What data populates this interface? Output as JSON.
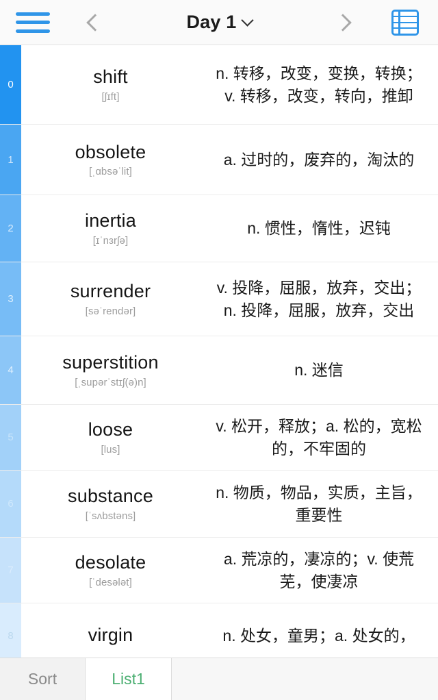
{
  "header": {
    "menu_icon": "hamburger-menu-icon",
    "prev_icon": "chevron-left-icon",
    "next_icon": "chevron-right-icon",
    "title": "Day 1",
    "title_caret_icon": "chevron-down-icon",
    "grid_icon": "list-grid-icon",
    "accent_color": "#2f95e8",
    "background": "#fafafa"
  },
  "list": {
    "index_gradient_from": "#2196f3",
    "index_gradient_to": "#d6e9fb",
    "rows": [
      {
        "index": "0",
        "word": "shift",
        "phonetic": "[ʃɪft]",
        "definition": "n. 转移，改变，变换，转换；v. 转移，改变，转向，推卸",
        "index_color": "#2293f0",
        "num_color": "#ffffff"
      },
      {
        "index": "1",
        "word": "obsolete",
        "phonetic": "[ˌɑbsəˈlit]",
        "definition": "a. 过时的，废弃的，淘汰的",
        "index_color": "#4aa6f2",
        "num_color": "#cfe6fb"
      },
      {
        "index": "2",
        "word": "inertia",
        "phonetic": "[ɪˈnɜrʃə]",
        "definition": "n. 惯性，惰性，迟钝",
        "index_color": "#63b2f4",
        "num_color": "#d8ecfd"
      },
      {
        "index": "3",
        "word": "surrender",
        "phonetic": "[səˈrendər]",
        "definition": "v. 投降，屈服，放弃，交出；n. 投降，屈服，放弃，交出",
        "index_color": "#77bcf6",
        "num_color": "#ddeffd"
      },
      {
        "index": "4",
        "word": "superstition",
        "phonetic": "[ˌsupərˈstɪʃ(ə)n]",
        "definition": "n. 迷信",
        "index_color": "#8cc6f7",
        "num_color": "#e2f1fe"
      },
      {
        "index": "5",
        "word": "loose",
        "phonetic": "[lus]",
        "definition": "v. 松开，释放；a. 松的，宽松的，不牢固的",
        "index_color": "#a2d1f9",
        "num_color": "#c8e4fb"
      },
      {
        "index": "6",
        "word": "substance",
        "phonetic": "[ˈsʌbstəns]",
        "definition": "n. 物质，物品，实质，主旨，重要性",
        "index_color": "#b4dafa",
        "num_color": "#cfe8fc"
      },
      {
        "index": "7",
        "word": "desolate",
        "phonetic": "[ˈdesələt]",
        "definition": "a. 荒凉的，凄凉的；v. 使荒芜，使凄凉",
        "index_color": "#c6e2fb",
        "num_color": "#dcedfd"
      },
      {
        "index": "8",
        "word": "virgin",
        "phonetic": "",
        "definition": "n. 处女，童男；a. 处女的，",
        "index_color": "#d9ecfd",
        "num_color": "#bcd9ef"
      }
    ]
  },
  "tabbar": {
    "sort_label": "Sort",
    "list_label": "List1",
    "active_tab": "List1",
    "active_color": "#4caf72",
    "inactive_color": "#8a8a8a"
  }
}
